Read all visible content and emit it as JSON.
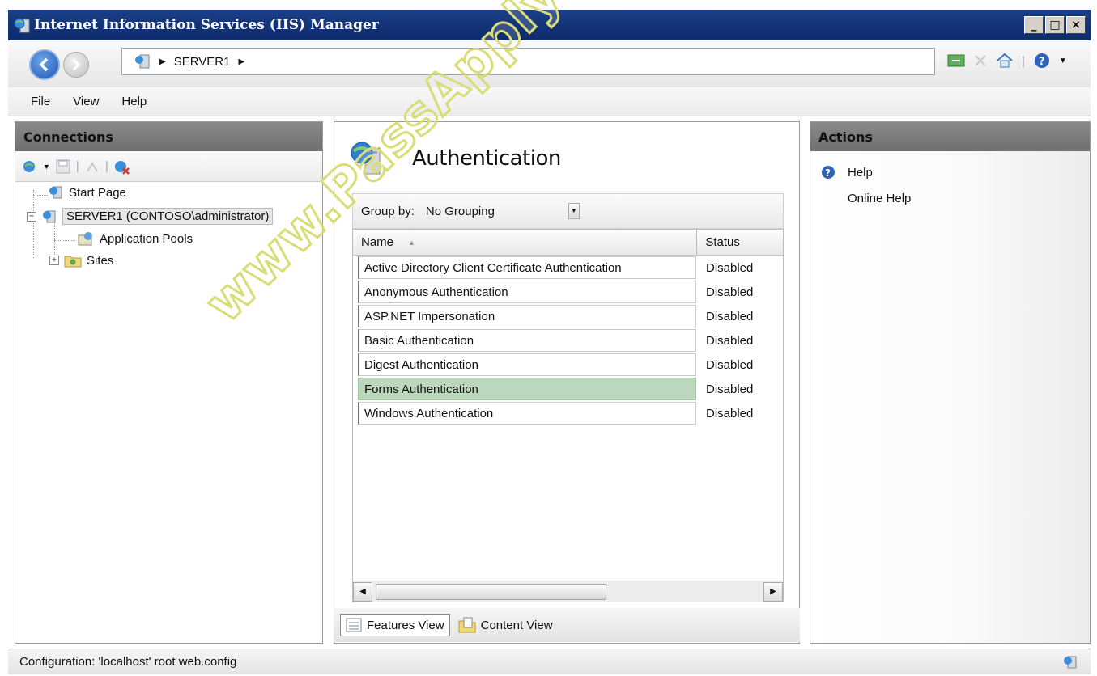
{
  "window": {
    "title": "Internet Information Services (IIS) Manager",
    "min": "_",
    "max": "□",
    "close": "×"
  },
  "address": {
    "path": "SERVER1"
  },
  "menu": {
    "file": "File",
    "view": "View",
    "help": "Help"
  },
  "connections": {
    "heading": "Connections",
    "tree": {
      "start_page": "Start Page",
      "server": "SERVER1 (CONTOSO\\administrator)",
      "app_pools": "Application Pools",
      "sites": "Sites"
    }
  },
  "feature": {
    "title": "Authentication",
    "group_by_label": "Group by:",
    "group_by_value": "No Grouping",
    "columns": {
      "name": "Name",
      "status": "Status"
    },
    "rows": [
      {
        "name": "Active Directory Client Certificate Authentication",
        "status": "Disabled"
      },
      {
        "name": "Anonymous Authentication",
        "status": "Disabled"
      },
      {
        "name": "ASP.NET Impersonation",
        "status": "Disabled"
      },
      {
        "name": "Basic Authentication",
        "status": "Disabled"
      },
      {
        "name": "Digest Authentication",
        "status": "Disabled"
      },
      {
        "name": "Forms Authentication",
        "status": "Disabled"
      },
      {
        "name": "Windows Authentication",
        "status": "Disabled"
      }
    ]
  },
  "view_tabs": {
    "features": "Features View",
    "content": "Content View"
  },
  "actions": {
    "heading": "Actions",
    "help": "Help",
    "online_help": "Online Help"
  },
  "statusbar": {
    "text": "Configuration: 'localhost' root web.config"
  },
  "watermark": "www.PassApply.com"
}
